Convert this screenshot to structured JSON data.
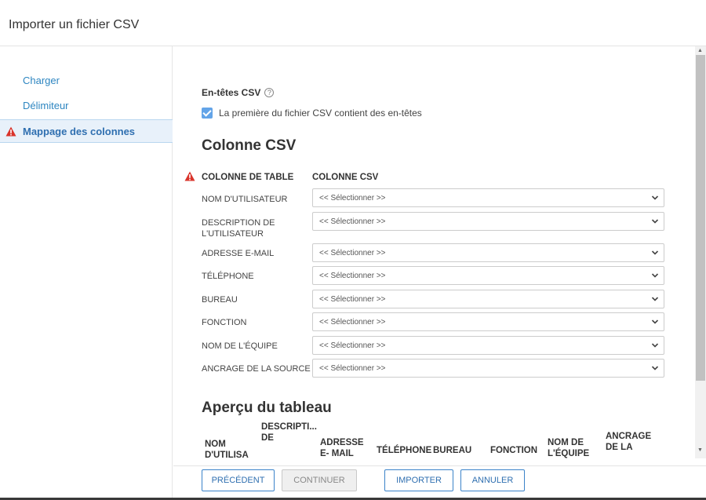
{
  "dialog": {
    "title": "Importer un fichier CSV"
  },
  "sidebar": {
    "items": [
      {
        "label": "Charger"
      },
      {
        "label": "Délimiteur"
      },
      {
        "label": "Mappage des colonnes"
      }
    ]
  },
  "csv_headers": {
    "label": "En-têtes CSV",
    "help": "?",
    "checkbox_label": "La première du fichier CSV contient des en-têtes",
    "checked": true
  },
  "mapping": {
    "title": "Colonne CSV",
    "col_table": "COLONNE DE TABLE",
    "col_csv": "COLONNE CSV",
    "rows": [
      {
        "label": "NOM D'UTILISATEUR",
        "value": "<< Sélectionner >>"
      },
      {
        "label": "DESCRIPTION DE L'UTILISATEUR",
        "value": "<< Sélectionner >>"
      },
      {
        "label": "ADRESSE E-MAIL",
        "value": "<< Sélectionner >>"
      },
      {
        "label": "TÉLÉPHONE",
        "value": "<< Sélectionner >>"
      },
      {
        "label": "BUREAU",
        "value": "<< Sélectionner >>"
      },
      {
        "label": "FONCTION",
        "value": "<< Sélectionner >>"
      },
      {
        "label": "NOM DE L'ÉQUIPE",
        "value": "<< Sélectionner >>"
      },
      {
        "label": "ANCRAGE DE LA SOURCE",
        "value": "<< Sélectionner >>"
      }
    ]
  },
  "preview": {
    "title": "Aperçu du tableau",
    "headers": [
      "NOM D'UTILISA",
      "DESCRIPTI... DE",
      "ADRESSE E- MAIL",
      "TÉLÉPHONE",
      "BUREAU",
      "FONCTION",
      "NOM DE L'ÉQUIPE",
      "ANCRAGE DE LA"
    ]
  },
  "footer": {
    "previous": "PRÉCÉDENT",
    "continue": "CONTINUER",
    "import": "IMPORTER",
    "cancel": "ANNULER"
  },
  "colors": {
    "accent": "#2f6fb0",
    "link": "#2e86c1",
    "warning": "#d9342b",
    "checkbox": "#63a4e8"
  }
}
